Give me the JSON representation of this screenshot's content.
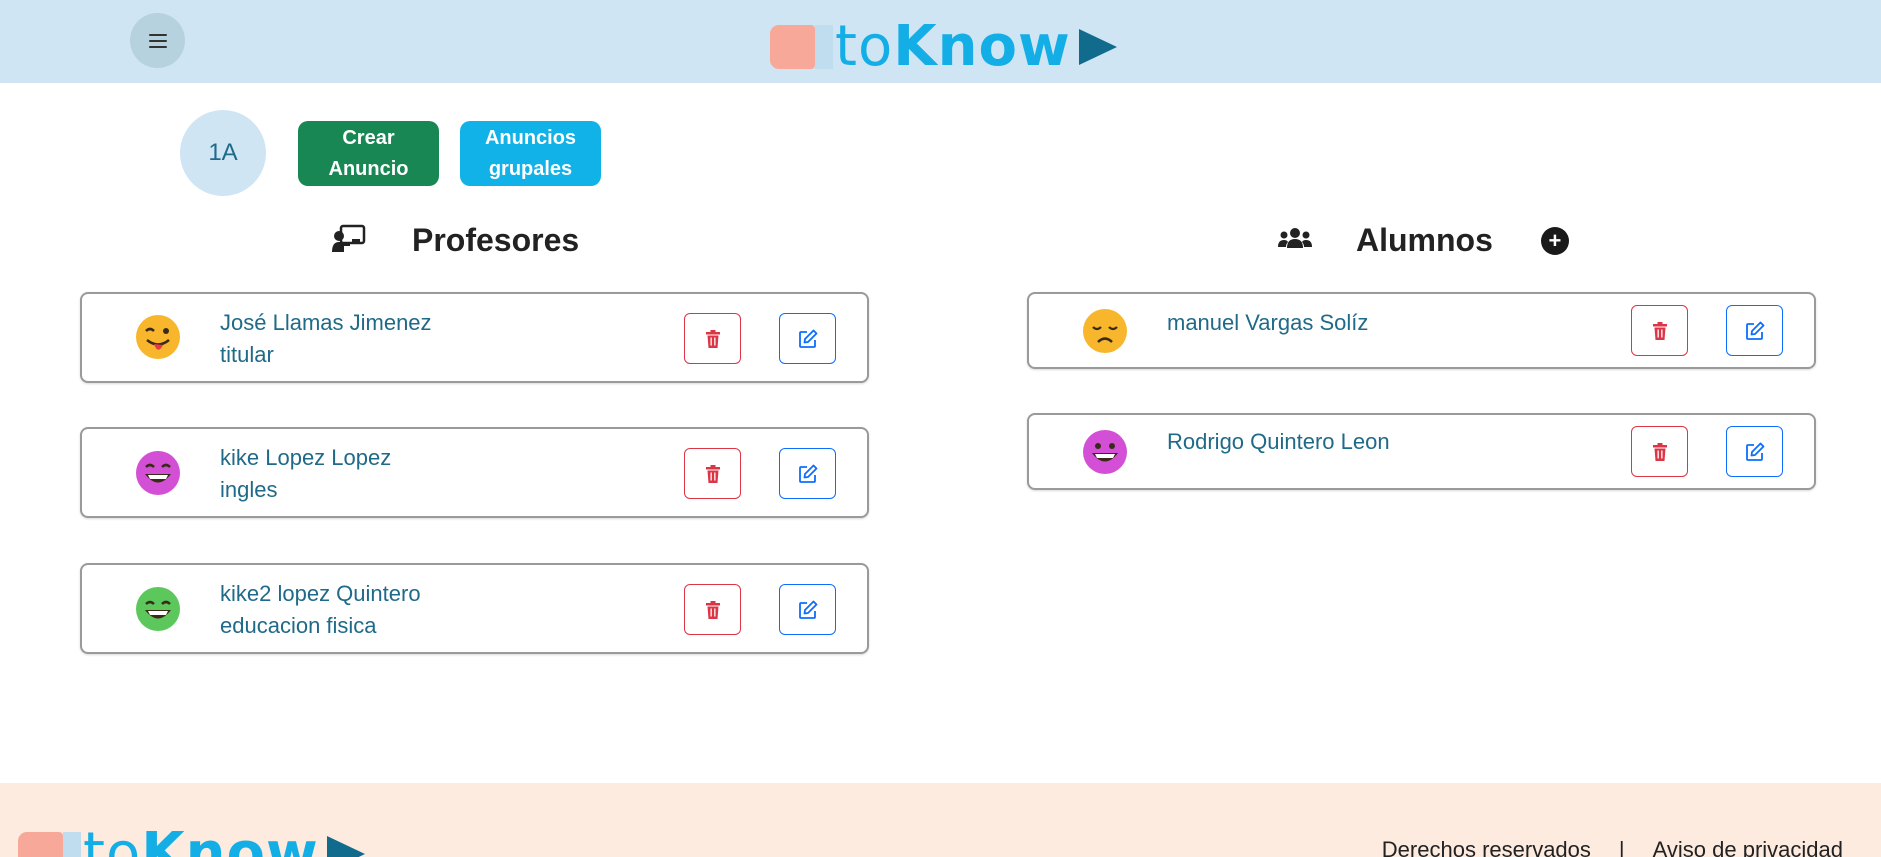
{
  "header": {
    "logo_text_light": "to",
    "logo_text_bold": "Know"
  },
  "group": {
    "label": "1A"
  },
  "actions": {
    "crear_anuncio": "Crear Anuncio",
    "anuncios_grupales": "Anuncios grupales"
  },
  "profesores": {
    "title": "Profesores",
    "items": [
      {
        "name": "José Llamas Jimenez",
        "subject": "titular",
        "emoji": "wink-tongue"
      },
      {
        "name": "kike Lopez Lopez",
        "subject": "ingles",
        "emoji": "grin"
      },
      {
        "name": "kike2 lopez Quintero",
        "subject": "educacion fisica",
        "emoji": "laugh"
      }
    ]
  },
  "alumnos": {
    "title": "Alumnos",
    "add_symbol": "+",
    "items": [
      {
        "name": "manuel Vargas Solíz",
        "emoji": "sad"
      },
      {
        "name": "Rodrigo Quintero Leon",
        "emoji": "grin-eyes"
      }
    ]
  },
  "footer": {
    "links": [
      "Derechos reservados",
      "|",
      "Aviso de privacidad"
    ]
  },
  "colors": {
    "header_bg": "#cfe5f4",
    "footer_bg": "#fdebe0",
    "primary_text": "#1f6a89",
    "success": "#198754",
    "info": "#10b2e8",
    "danger": "#dc3545",
    "edit": "#0d6efd"
  }
}
